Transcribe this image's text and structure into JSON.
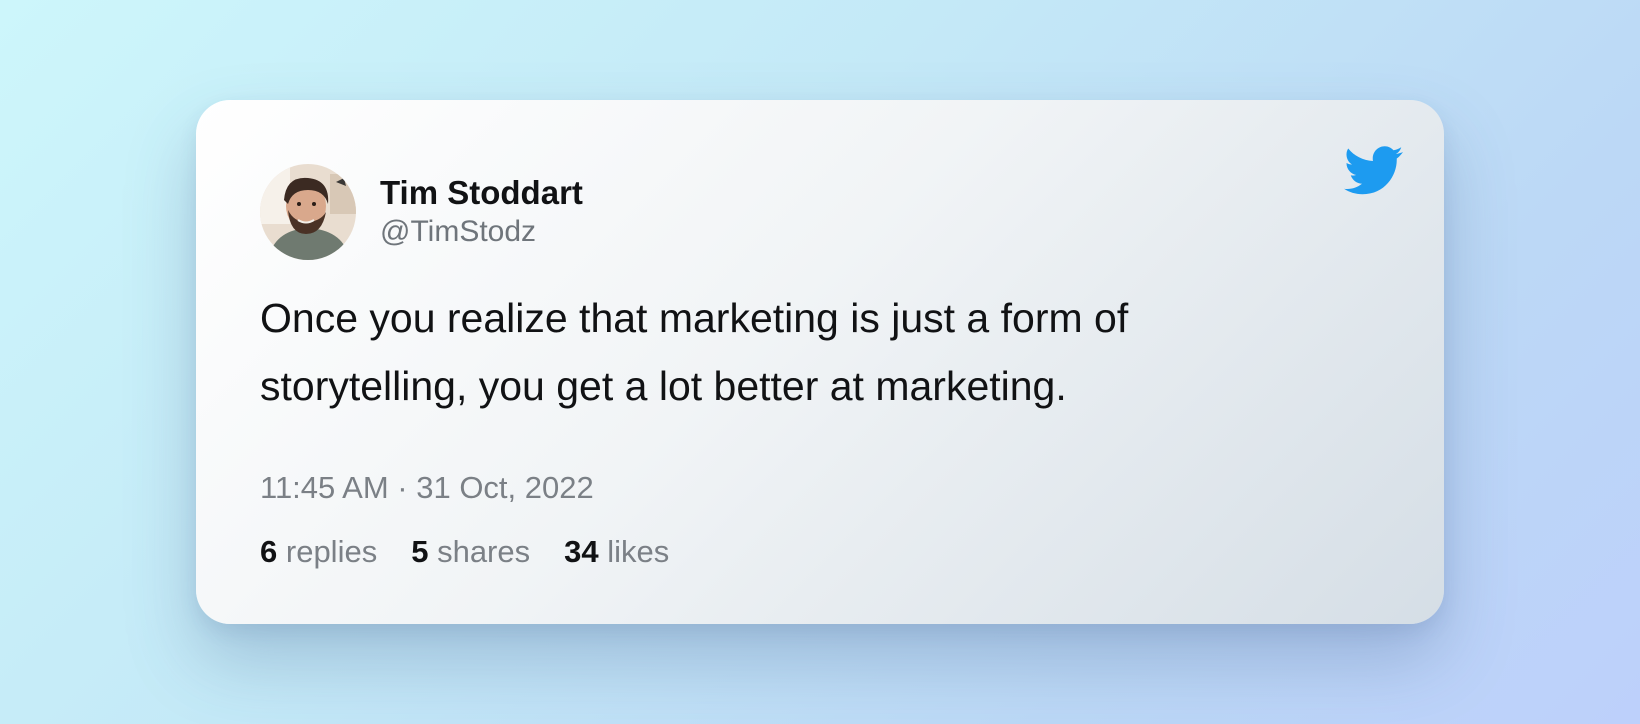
{
  "tweet": {
    "author": {
      "name": "Tim Stoddart",
      "handle": "@TimStodz",
      "avatar_icon": "user-photo-avatar"
    },
    "text": "Once you realize that marketing is just a form of storytelling, you get a lot better at marketing.",
    "timestamp": "11:45 AM · 31 Oct, 2022",
    "stats": [
      {
        "count": "6",
        "label": "replies"
      },
      {
        "count": "5",
        "label": "shares"
      },
      {
        "count": "34",
        "label": "likes"
      }
    ],
    "brand_icon": "twitter-bird-icon"
  },
  "colors": {
    "background_start": "#cdf6fb",
    "background_end": "#bdd0fb",
    "twitter_blue": "#1d9bf0",
    "primary_text": "#111214",
    "secondary_text": "#7b8086"
  }
}
